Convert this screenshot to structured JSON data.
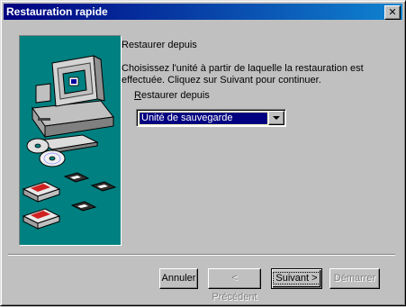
{
  "window": {
    "title": "Restauration rapide",
    "close_glyph": "✕"
  },
  "content": {
    "heading": "Restaurer depuis",
    "description": "Choisissez l'unité à partir de laquelle la restauration est effectuée. Cliquez sur Suivant pour continuer.",
    "field_label": "Restaurer depuis",
    "field_label_accel": "R",
    "field_label_rest": "estaurer depuis",
    "combo_value": "Unité de sauvegarde"
  },
  "buttons": {
    "cancel": "Annuler",
    "previous": "< Précédent",
    "next": "Suivant >",
    "start": "Démarrer"
  },
  "colors": {
    "titlebar_start": "#000080",
    "titlebar_end": "#1084d0",
    "panel_bg": "#008080",
    "selection": "#000080"
  },
  "icons": [
    "computer-icon",
    "cd-disc-icon",
    "floppy-disk-icon",
    "tape-cartridge-icon"
  ]
}
